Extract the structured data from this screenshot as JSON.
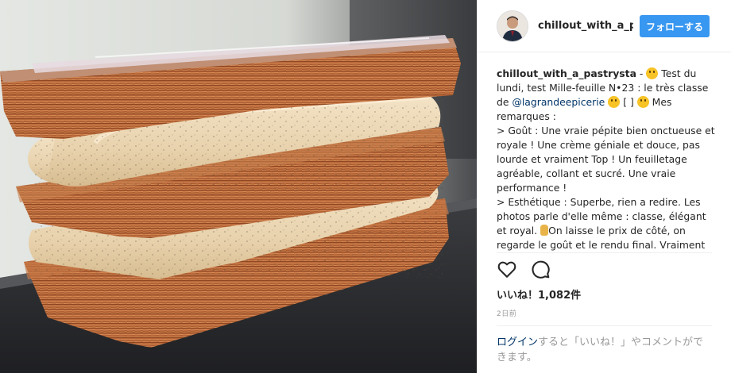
{
  "post": {
    "image_alt": "Mille-feuille pastry with vanilla cream layers"
  },
  "header": {
    "username": "chillout_with_a_pa",
    "follow_label": "フォローする"
  },
  "caption": {
    "username": "chillout_with_a_pastrysta",
    "text_part1": " - ",
    "text_part2": " Test du lundi, test Mille-feuille N•23 : le très classe de ",
    "mention": "@lagrandeepicerie",
    "text_part3": " [ ] ",
    "text_part4": " Mes remarques :",
    "line_gout": "> Goût : Une vraie pépite bien onctueuse et royale ! Une crème géniale et douce, pas lourde et vraiment Top ! Un feuilletage agréable, collant et sucré. Une vraie performance !",
    "line_esth_a": "> Esthétique : Superbe, rien a redire. Les photos parle d'elle même : classe, élégant et royal. ",
    "line_esth_b": "On laisse le prix de côté, on regarde le goût et le rendu final. Vraiment"
  },
  "actions": {
    "like_icon": "heart-icon",
    "comment_icon": "comment-icon"
  },
  "likes": {
    "text": "いいね！1,082件"
  },
  "timestamp": "2日前",
  "login": {
    "link": "ログイン",
    "rest": "すると「いいね！」やコメントができます。"
  },
  "colors": {
    "follow_button": "#3897f0",
    "link": "#003569",
    "muted": "#999999"
  }
}
